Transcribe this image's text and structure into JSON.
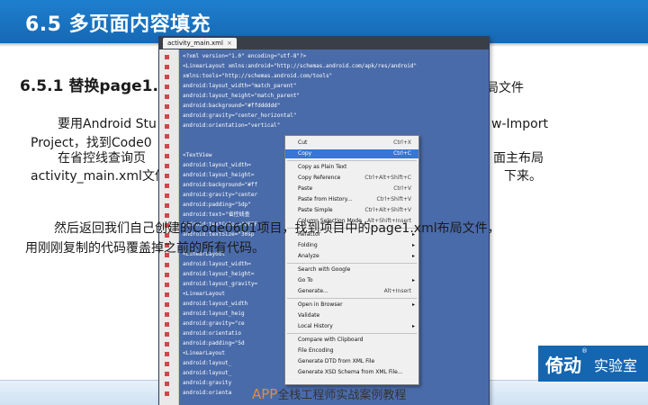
{
  "slide": {
    "title": "6.5 多页面内容填充",
    "subtitle": "6.5.1 替换page1.",
    "subtitle_tail": "局文件",
    "para1_line1": "要用Android Stu",
    "para1_line1_tail": "w-Import",
    "para1_line2": "Project，找到Code0",
    "para2_line1": "在省控线查询页",
    "para2_line1_tail": "面主布局",
    "para2_line2": "activity_main.xml文件",
    "para2_line2_tail": "下来。",
    "para3_line1": "然后返回我们自己创建的Code0601项目，找到项目中的page1.xml布局文件，",
    "para3_line2": "用刚刚复制的代码覆盖掉之前的所有代码。",
    "footer_app": "APP",
    "footer_rest": "全栈工程师实战案例教程",
    "brand_logo1": "倚动",
    "brand_logo2": "实验室",
    "brand_reg": "®"
  },
  "ide": {
    "tab_label": "activity_main.xml",
    "tab_close": "×",
    "code_lines": [
      "<?xml version=\"1.0\" encoding=\"utf-8\"?>",
      "<LinearLayout xmlns:android=\"http://schemas.android.com/apk/res/android\"",
      "    xmlns:tools=\"http://schemas.android.com/tools\"",
      "    android:layout_width=\"match_parent\"",
      "    android:layout_height=\"match_parent\"",
      "    android:background=\"#ffdddddd\"",
      "    android:gravity=\"center_horizontal\"",
      "    android:orientation=\"vertical\"",
      "",
      "",
      "    <TextView",
      "        android:layout_width=",
      "        android:layout_height=",
      "        android:background=\"#ff",
      "        android:gravity=\"center",
      "        android:padding=\"5dp\"",
      "        android:text=\"省控线查",
      "        android:textColor=\"#FFF",
      "        android:textSize=\"30sp",
      "",
      "    <LinearLayout",
      "        android:layout_width=",
      "        android:layout_height=",
      "        android:layout_gravity=",
      "        <LinearLayout",
      "            android:layout_width",
      "            android:layout_heig",
      "            android:gravity=\"ce",
      "            android:orientatio",
      "            android:padding=\"5d",
      "            <LinearLayout",
      "                android:layout_",
      "                android:layout_",
      "                android:gravity",
      "                android:orienta"
    ]
  },
  "context_menu": {
    "items": [
      {
        "label": "Cut",
        "shortcut": "Ctrl+X",
        "selected": false
      },
      {
        "label": "Copy",
        "shortcut": "Ctrl+C",
        "selected": true
      },
      {
        "label": "Copy as Plain Text",
        "shortcut": "",
        "selected": false
      },
      {
        "label": "Copy Reference",
        "shortcut": "Ctrl+Alt+Shift+C",
        "selected": false
      },
      {
        "label": "Paste",
        "shortcut": "Ctrl+V",
        "selected": false
      },
      {
        "label": "Paste from History...",
        "shortcut": "Ctrl+Shift+V",
        "selected": false
      },
      {
        "label": "Paste Simple",
        "shortcut": "Ctrl+Alt+Shift+V",
        "selected": false
      },
      {
        "label": "Column Selection Mode",
        "shortcut": "Alt+Shift+Insert",
        "selected": false
      },
      {
        "label": "Refactor",
        "shortcut": "",
        "selected": false,
        "submenu": true
      },
      {
        "label": "Folding",
        "shortcut": "",
        "selected": false,
        "submenu": true
      },
      {
        "label": "Analyze",
        "shortcut": "",
        "selected": false,
        "submenu": true
      },
      {
        "label": "Search with Google",
        "shortcut": "",
        "selected": false
      },
      {
        "label": "Go To",
        "shortcut": "",
        "selected": false,
        "submenu": true
      },
      {
        "label": "Generate...",
        "shortcut": "Alt+Insert",
        "selected": false
      },
      {
        "label": "Open in Browser",
        "shortcut": "",
        "selected": false,
        "submenu": true
      },
      {
        "label": "Validate",
        "shortcut": "",
        "selected": false
      },
      {
        "label": "Local History",
        "shortcut": "",
        "selected": false,
        "submenu": true
      },
      {
        "label": "Compare with Clipboard",
        "shortcut": "",
        "selected": false
      },
      {
        "label": "File Encoding",
        "shortcut": "",
        "selected": false
      },
      {
        "label": "Generate DTD from XML File",
        "shortcut": "",
        "selected": false
      },
      {
        "label": "Generate XSD Schema from XML File...",
        "shortcut": "",
        "selected": false
      }
    ],
    "submenu_arrow": "▸"
  },
  "colors": {
    "header_blue": "#1668b3",
    "editor_bg": "#4a6ba9",
    "menu_highlight": "#3875d7",
    "footer_accent": "#e09030"
  }
}
